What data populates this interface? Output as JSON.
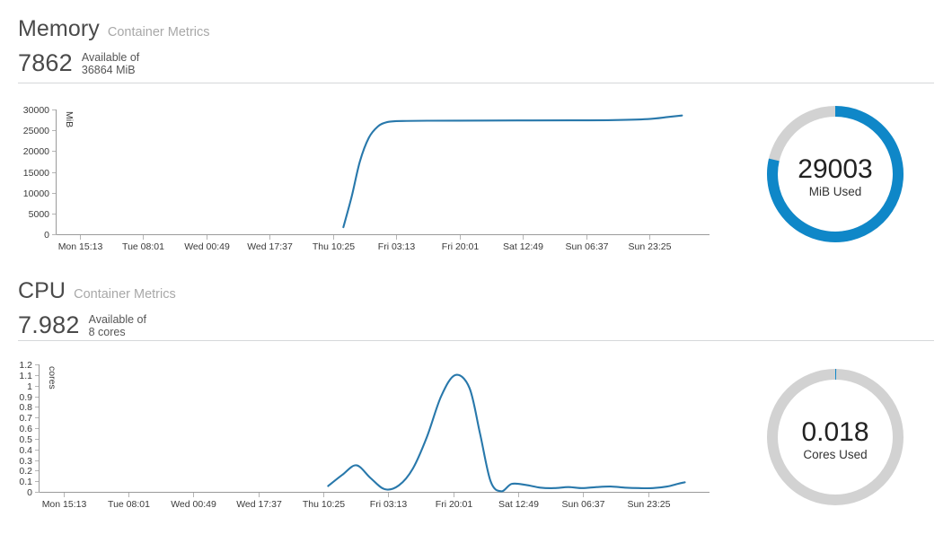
{
  "memory": {
    "title": "Memory",
    "subtitle": "Container Metrics",
    "available_value": "7862",
    "available_caption_line1": "Available of",
    "available_caption_line2": "36864 MiB",
    "gauge": {
      "value": "29003",
      "label": "MiB Used",
      "used": 29003,
      "total": 36864,
      "fill_color": "#0f87c8",
      "track_color": "#d2d2d2"
    }
  },
  "cpu": {
    "title": "CPU",
    "subtitle": "Container Metrics",
    "available_value": "7.982",
    "available_caption_line1": "Available of",
    "available_caption_line2": "8 cores",
    "gauge": {
      "value": "0.018",
      "label": "Cores Used",
      "used": 0.018,
      "total": 8,
      "fill_color": "#0f87c8",
      "track_color": "#d2d2d2"
    }
  },
  "chart_data": [
    {
      "id": "memory-chart",
      "type": "line",
      "title": "Memory",
      "xlabel": "",
      "ylabel": "MiB",
      "ylim": [
        0,
        30000
      ],
      "yticks": [
        0,
        5000,
        10000,
        15000,
        20000,
        25000,
        30000
      ],
      "ytick_labels": [
        "0",
        "5000",
        "10000",
        "15000",
        "20000",
        "25000",
        "30000"
      ],
      "xtick_labels": [
        "Mon 15:13",
        "Tue 08:01",
        "Wed 00:49",
        "Wed 17:37",
        "Thu 10:25",
        "Fri 03:13",
        "Fri 20:01",
        "Sat 12:49",
        "Sun 06:37",
        "Sun 23:25"
      ],
      "grid": false,
      "legend": "none",
      "line_color": "#2878ab",
      "series": [
        {
          "name": "Memory used",
          "x": [
            4.18,
            4.3,
            4.42,
            4.55,
            4.68,
            4.8,
            4.95,
            5.1,
            5.4,
            5.8,
            6.3,
            6.9,
            7.5,
            8.1,
            8.6,
            8.9,
            9.1
          ],
          "values": [
            1700,
            9000,
            17500,
            23200,
            25900,
            26900,
            27200,
            27250,
            27300,
            27320,
            27350,
            27380,
            27400,
            27450,
            27700,
            28200,
            28550
          ]
        }
      ]
    },
    {
      "id": "cpu-chart",
      "type": "line",
      "title": "CPU",
      "xlabel": "",
      "ylabel": "cores",
      "ylim": [
        0,
        1.2
      ],
      "yticks": [
        0,
        0.1,
        0.2,
        0.3,
        0.4,
        0.5,
        0.6,
        0.7,
        0.8,
        0.9,
        1.0,
        1.1,
        1.2
      ],
      "ytick_labels": [
        "0",
        "0.1",
        "0.2",
        "0.3",
        "0.4",
        "0.5",
        "0.6",
        "0.7",
        "0.8",
        "0.9",
        "1",
        "1.1",
        "1.2"
      ],
      "xtick_labels": [
        "Mon 15:13",
        "Tue 08:01",
        "Wed 00:49",
        "Wed 17:37",
        "Thu 10:25",
        "Fri 03:13",
        "Fri 20:01",
        "Sat 12:49",
        "Sun 06:37",
        "Sun 23:25"
      ],
      "grid": false,
      "legend": "none",
      "line_color": "#2878ab",
      "series": [
        {
          "name": "Cores used",
          "x": [
            4.1,
            4.3,
            4.5,
            4.7,
            4.9,
            5.1,
            5.3,
            5.5,
            5.7,
            5.9,
            6.1,
            6.25,
            6.4,
            6.55,
            6.7,
            6.9,
            7.1,
            7.3,
            7.5,
            7.7,
            7.9,
            8.1,
            8.3,
            8.5,
            8.7,
            8.9,
            9.05,
            9.15
          ],
          "values": [
            0.055,
            0.16,
            0.25,
            0.13,
            0.025,
            0.06,
            0.22,
            0.52,
            0.9,
            1.1,
            0.98,
            0.55,
            0.1,
            0.005,
            0.075,
            0.065,
            0.04,
            0.035,
            0.045,
            0.035,
            0.045,
            0.05,
            0.04,
            0.035,
            0.035,
            0.05,
            0.075,
            0.09
          ]
        }
      ]
    }
  ]
}
